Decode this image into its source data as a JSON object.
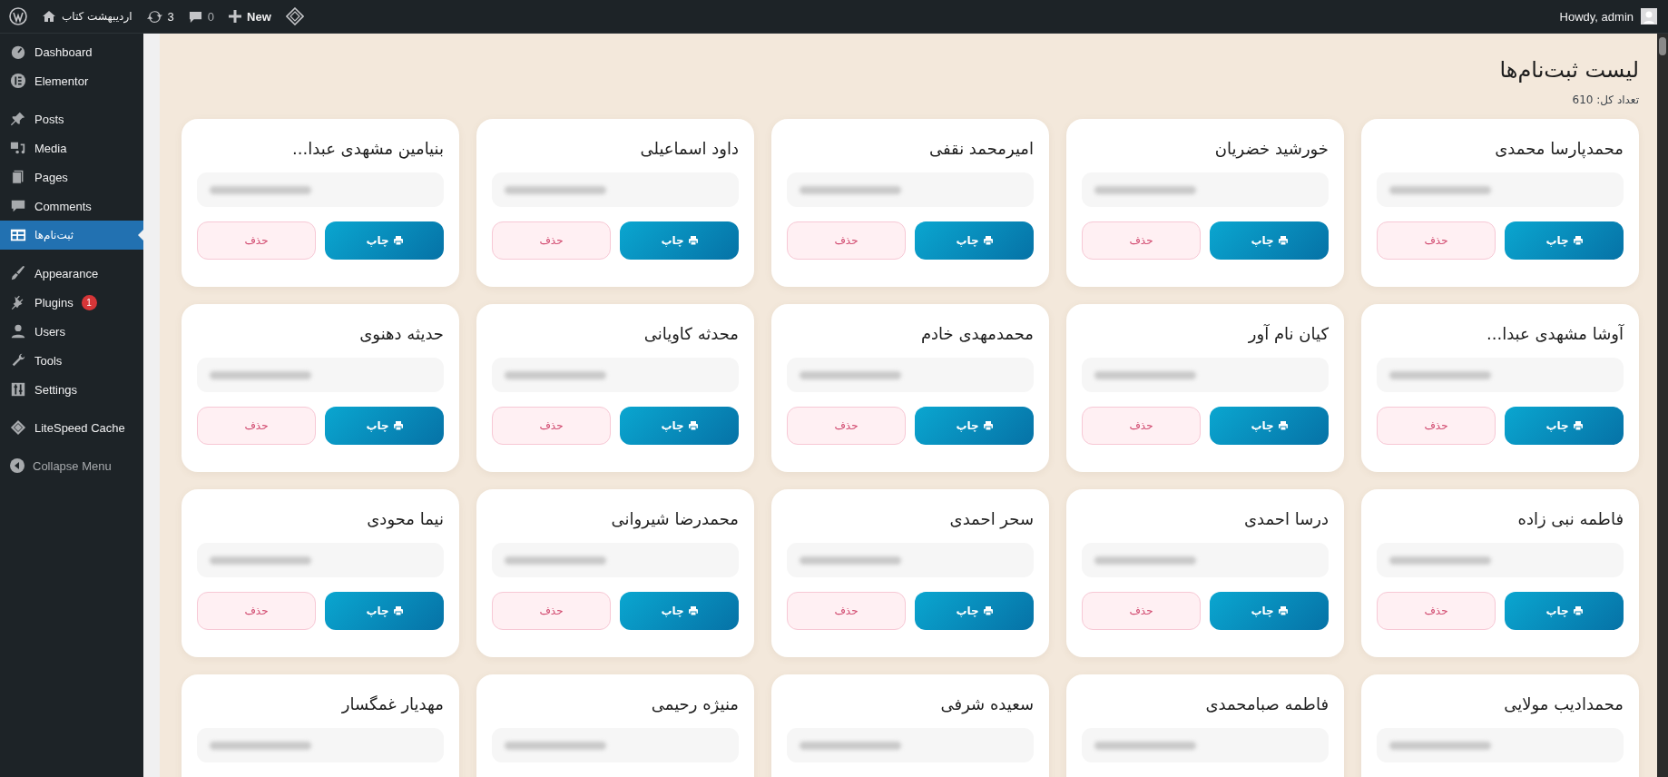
{
  "admin_bar": {
    "site_name": "اردیبهشت کتاب",
    "updates_count": "3",
    "comments_count": "0",
    "new_label": "New",
    "greeting": "Howdy, admin"
  },
  "sidebar": {
    "groups": [
      {
        "items": [
          {
            "label": "Dashboard",
            "selected": false
          },
          {
            "label": "Elementor",
            "selected": false
          }
        ]
      },
      {
        "items": [
          {
            "label": "Posts",
            "selected": false
          },
          {
            "label": "Media",
            "selected": false
          },
          {
            "label": "Pages",
            "selected": false
          },
          {
            "label": "Comments",
            "selected": false
          },
          {
            "label": "ثبت‌نام‌ها",
            "selected": true
          }
        ]
      },
      {
        "items": [
          {
            "label": "Appearance",
            "selected": false
          },
          {
            "label": "Plugins",
            "selected": false,
            "badge": "1"
          },
          {
            "label": "Users",
            "selected": false
          },
          {
            "label": "Tools",
            "selected": false
          },
          {
            "label": "Settings",
            "selected": false
          }
        ]
      },
      {
        "items": [
          {
            "label": "LiteSpeed Cache",
            "selected": false
          }
        ]
      }
    ],
    "collapse_label": "Collapse Menu"
  },
  "page": {
    "title": "لیست ثبت‌نام‌ها",
    "total": "تعداد کل: 610"
  },
  "cards": [
    {
      "name": "محمدپارسا محمدی",
      "print_label": "چاپ",
      "delete_label": "حذف"
    },
    {
      "name": "خورشید خضریان",
      "print_label": "چاپ",
      "delete_label": "حذف"
    },
    {
      "name": "امیرمحمد نقفی",
      "print_label": "چاپ",
      "delete_label": "حذف"
    },
    {
      "name": "داود اسماعیلی",
      "print_label": "چاپ",
      "delete_label": "حذف"
    },
    {
      "name": "بنیامین مشهدی عبدا...",
      "print_label": "چاپ",
      "delete_label": "حذف"
    },
    {
      "name": "آوشا مشهدی عبدا...",
      "print_label": "چاپ",
      "delete_label": "حذف"
    },
    {
      "name": "کیان نام آور",
      "print_label": "چاپ",
      "delete_label": "حذف"
    },
    {
      "name": "محمدمهدی خادم",
      "print_label": "چاپ",
      "delete_label": "حذف"
    },
    {
      "name": "محدثه کاویانی",
      "print_label": "چاپ",
      "delete_label": "حذف"
    },
    {
      "name": "حدیثه دهنوی",
      "print_label": "چاپ",
      "delete_label": "حذف"
    },
    {
      "name": "فاطمه نبی زاده",
      "print_label": "چاپ",
      "delete_label": "حذف"
    },
    {
      "name": "درسا احمدی",
      "print_label": "چاپ",
      "delete_label": "حذف"
    },
    {
      "name": "سحر احمدی",
      "print_label": "چاپ",
      "delete_label": "حذف"
    },
    {
      "name": "محمدرضا شیروانی",
      "print_label": "چاپ",
      "delete_label": "حذف"
    },
    {
      "name": "نیما محودی",
      "print_label": "چاپ",
      "delete_label": "حذف"
    },
    {
      "name": "محمدادیب مولایی"
    },
    {
      "name": "فاطمه صبامحمدی"
    },
    {
      "name": "سعیده شرفی"
    },
    {
      "name": "منیژه رحیمی"
    },
    {
      "name": "مهدیار غمگسار"
    }
  ]
}
